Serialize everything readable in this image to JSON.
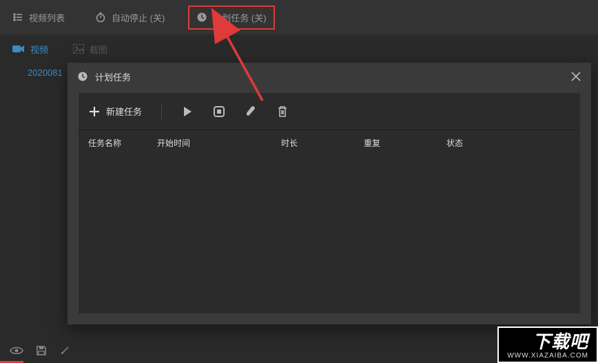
{
  "topbar": {
    "video_list_label": "视频列表",
    "auto_stop_label": "自动停止 (关)",
    "scheduled_task_label": "计划任务 (关)"
  },
  "secondbar": {
    "video_tab": "视频",
    "screenshot_tab": "截图"
  },
  "file_item": "2020081",
  "dialog": {
    "title": "计划任务",
    "new_task_label": "新建任务",
    "columns": {
      "name": "任务名称",
      "start": "开始时间",
      "duration": "时长",
      "repeat": "重复",
      "status": "状态"
    }
  },
  "watermark": {
    "brand": "下载吧",
    "url": "WWW.XIAZAIBA.COM"
  }
}
